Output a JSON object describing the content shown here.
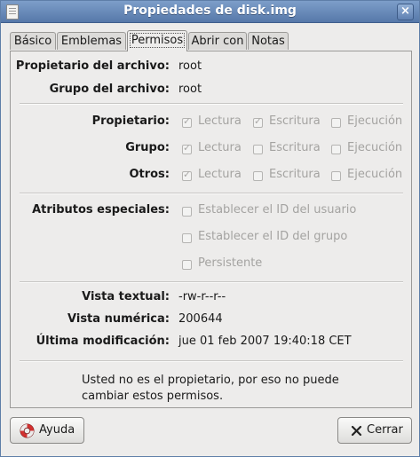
{
  "window": {
    "title": "Propiedades de disk.img",
    "close_symbol": "×"
  },
  "tabs": [
    {
      "label": "Básico",
      "active": false
    },
    {
      "label": "Emblemas",
      "active": false
    },
    {
      "label": "Permisos",
      "active": true
    },
    {
      "label": "Abrir con",
      "active": false
    },
    {
      "label": "Notas",
      "active": false
    }
  ],
  "ownership": {
    "owner_label": "Propietario del archivo:",
    "owner_value": "root",
    "group_label": "Grupo del archivo:",
    "group_value": "root"
  },
  "permissions": {
    "rows": [
      {
        "label": "Propietario:",
        "read": "Lectura",
        "read_checked": true,
        "write": "Escritura",
        "write_checked": true,
        "exec": "Ejecución",
        "exec_checked": false
      },
      {
        "label": "Grupo:",
        "read": "Lectura",
        "read_checked": true,
        "write": "Escritura",
        "write_checked": false,
        "exec": "Ejecución",
        "exec_checked": false
      },
      {
        "label": "Otros:",
        "read": "Lectura",
        "read_checked": true,
        "write": "Escritura",
        "write_checked": false,
        "exec": "Ejecución",
        "exec_checked": false
      }
    ]
  },
  "special": {
    "label": "Atributos especiales:",
    "options": [
      {
        "label": "Establecer el ID del usuario",
        "checked": false
      },
      {
        "label": "Establecer el ID del grupo",
        "checked": false
      },
      {
        "label": "Persistente",
        "checked": false
      }
    ]
  },
  "info": {
    "text_view_label": "Vista textual:",
    "text_view_value": "-rw-r--r--",
    "numeric_view_label": "Vista numérica:",
    "numeric_view_value": "200644",
    "modified_label": "Última modificación:",
    "modified_value": "jue 01 feb 2007 19:40:18 CET"
  },
  "message": {
    "line1": "Usted no es el propietario, por eso no puede",
    "line2": "cambiar estos permisos."
  },
  "buttons": {
    "help": "Ayuda",
    "close": "Cerrar"
  },
  "colors": {
    "titlebar": "#5678a9",
    "background": "#edeceb",
    "disabled_text": "#a4a3a1"
  },
  "icons": {
    "window": "document-icon",
    "help": "lifebuoy-icon",
    "close": "x-icon"
  }
}
